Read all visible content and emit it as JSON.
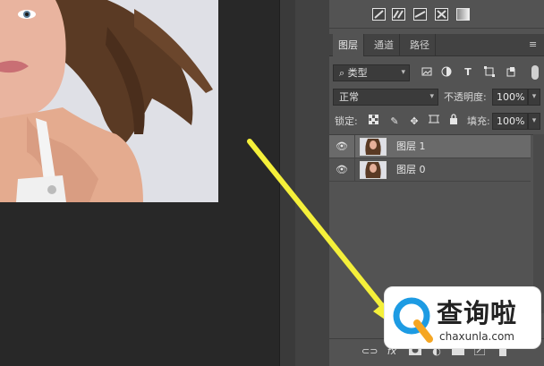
{
  "layers_panel": {
    "tabs": [
      {
        "label": "图层"
      },
      {
        "label": "通道"
      },
      {
        "label": "路径"
      }
    ],
    "filter": {
      "kind_label": "类型",
      "icons": [
        "image-filter-icon",
        "adjustment-filter-icon",
        "type-filter-icon",
        "shape-filter-icon",
        "smart-object-filter-icon",
        "filter-toggle"
      ]
    },
    "blend_mode": "正常",
    "opacity_label": "不透明度:",
    "opacity_value": "100%",
    "lock_label": "锁定:",
    "lock_icons": [
      "lock-transparent-pixels-icon",
      "lock-image-pixels-icon",
      "lock-position-icon",
      "lock-artboard-icon",
      "lock-all-icon"
    ],
    "fill_label": "填充:",
    "fill_value": "100%",
    "layers": [
      {
        "name": "图层 1",
        "selected": true,
        "visible": true
      },
      {
        "name": "图层 0",
        "selected": false,
        "visible": true
      }
    ],
    "bottom_icons": [
      "link-layers-icon",
      "fx-icon",
      "add-mask-icon",
      "adjustment-layer-icon",
      "group-icon",
      "new-layer-icon",
      "delete-layer-icon"
    ]
  },
  "watermark": {
    "title": "查询啦",
    "url": "chaxunla.com"
  },
  "colors": {
    "arrow": "#f5f03a",
    "panel_bg": "#535353",
    "canvas_bg": "#282828",
    "selected_row": "#6a6a6a",
    "watermark_blue": "#1d9be3",
    "watermark_orange": "#f5a623"
  }
}
